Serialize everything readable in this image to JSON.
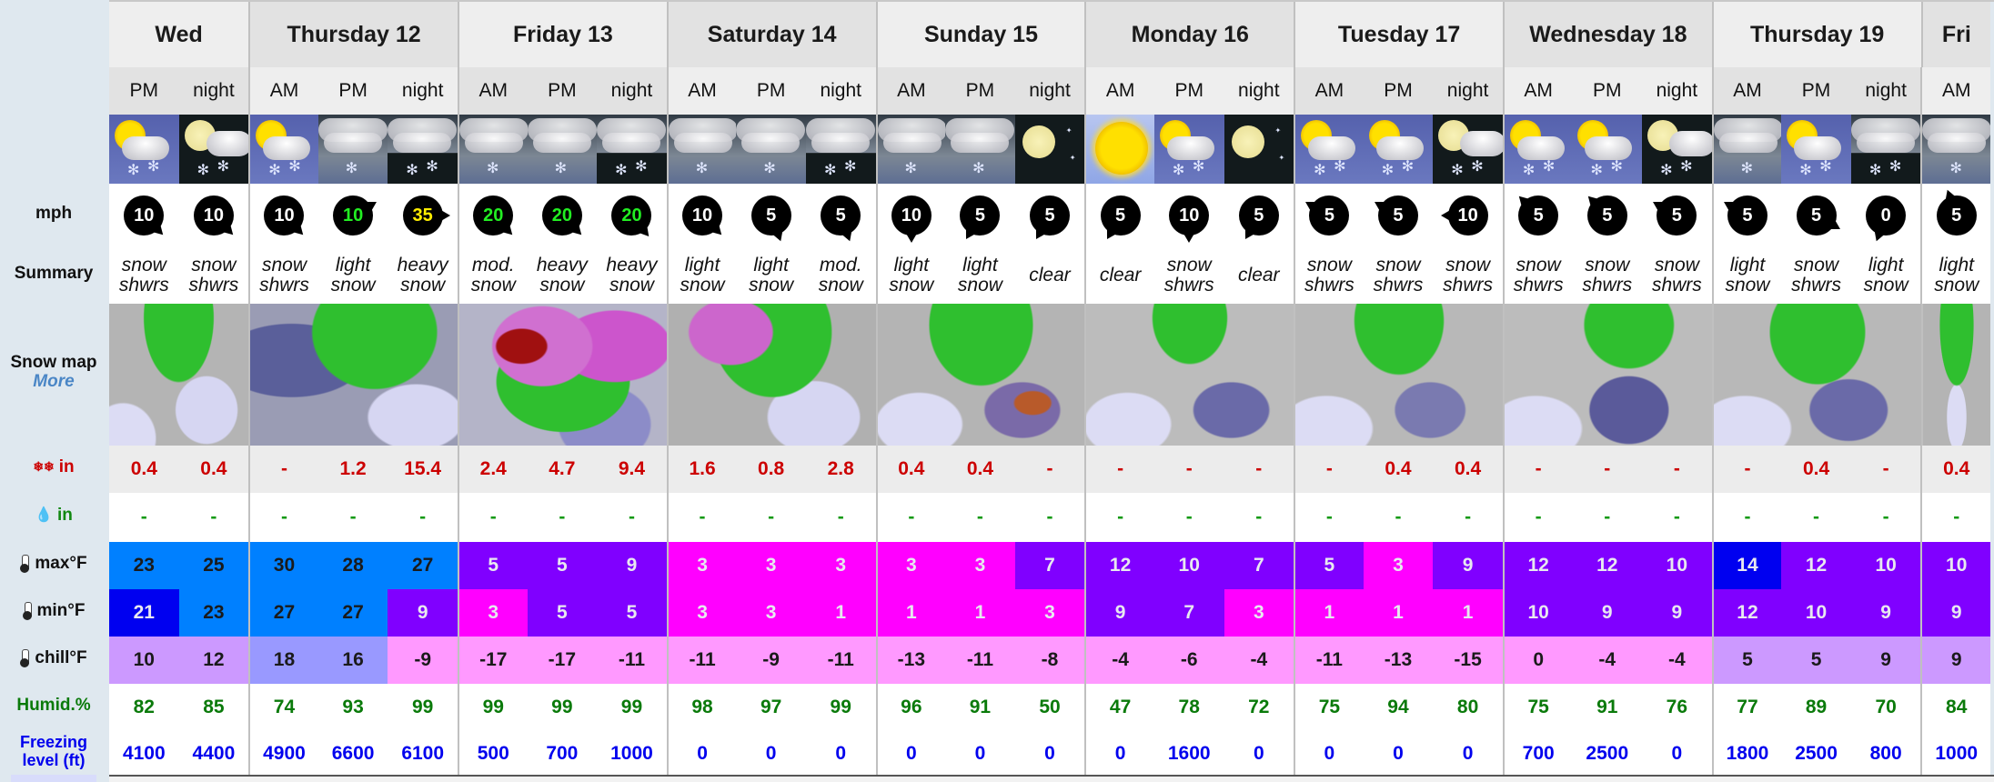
{
  "labels": {
    "wind": "mph",
    "summary": "Summary",
    "snow_map": "Snow map",
    "snow_map_more": "More",
    "snow": "in",
    "rain": "in",
    "max": "max°F",
    "min": "min°F",
    "chill": "chill°F",
    "humid": "Humid.%",
    "freezing_line1": "Freezing",
    "freezing_line2": "level (ft)"
  },
  "days": [
    {
      "name": "Wed",
      "periods": 2
    },
    {
      "name": "Thursday 12",
      "periods": 3
    },
    {
      "name": "Friday 13",
      "periods": 3
    },
    {
      "name": "Saturday 14",
      "periods": 3
    },
    {
      "name": "Sunday 15",
      "periods": 3
    },
    {
      "name": "Monday 16",
      "periods": 3
    },
    {
      "name": "Tuesday 17",
      "periods": 3
    },
    {
      "name": "Wednesday 18",
      "periods": 3
    },
    {
      "name": "Thursday 19",
      "periods": 3
    },
    {
      "name": "Fri",
      "periods": 1
    }
  ],
  "colors": {
    "snow_text": "#cc0000",
    "rain_text": "#119911",
    "humid_text": "#0a7a0a",
    "freezing_text": "#0000ee",
    "wind_green": "#22ee22",
    "wind_yellow": "#ffee00",
    "temp_blue_light": "#0080ff",
    "temp_blue_dark": "#0000f0",
    "temp_violet": "#8000ff",
    "temp_magenta": "#ff00ff",
    "chill_lavender": "#cc99ff",
    "chill_periwinkle": "#9999ff",
    "chill_pink": "#ff99ff"
  },
  "columns": [
    {
      "period": "PM",
      "icon": "sun-cloud-snow",
      "wind": 10,
      "wind_dir": 45,
      "wind_color": "white",
      "summary": [
        "snow",
        "shwrs"
      ],
      "snow": "0.4",
      "rain": "-",
      "max": 23,
      "max_bg": "blue_light",
      "min": 21,
      "min_bg": "blue_dark",
      "chill": 10,
      "chill_bg": "lavender",
      "humid": 82,
      "freezing": 4100
    },
    {
      "period": "night",
      "icon": "moon-cloud-snow",
      "wind": 10,
      "wind_dir": 45,
      "wind_color": "white",
      "summary": [
        "snow",
        "shwrs"
      ],
      "snow": "0.4",
      "rain": "-",
      "max": 25,
      "max_bg": "blue_light",
      "min": 23,
      "min_bg": "blue_light",
      "chill": 12,
      "chill_bg": "lavender",
      "humid": 85,
      "freezing": 4400
    },
    {
      "period": "AM",
      "icon": "sun-cloud-snow",
      "wind": 10,
      "wind_dir": 45,
      "wind_color": "white",
      "summary": [
        "snow",
        "shwrs"
      ],
      "snow": "-",
      "rain": "-",
      "max": 30,
      "max_bg": "blue_light",
      "min": 27,
      "min_bg": "blue_light",
      "chill": 18,
      "chill_bg": "periwinkle",
      "humid": 74,
      "freezing": 4900
    },
    {
      "period": "PM",
      "icon": "overcast-snow",
      "wind": 10,
      "wind_dir": -30,
      "wind_color": "green",
      "summary": [
        "light",
        "snow"
      ],
      "snow": "1.2",
      "rain": "-",
      "max": 28,
      "max_bg": "blue_light",
      "min": 27,
      "min_bg": "blue_light",
      "chill": 16,
      "chill_bg": "periwinkle",
      "humid": 93,
      "freezing": 6600
    },
    {
      "period": "night",
      "icon": "overcast-night-snow",
      "wind": 35,
      "wind_dir": 0,
      "wind_color": "yellow",
      "summary": [
        "heavy",
        "snow"
      ],
      "snow": "15.4",
      "rain": "-",
      "max": 27,
      "max_bg": "blue_light",
      "min": 9,
      "min_bg": "violet",
      "chill": -9,
      "chill_bg": "pink",
      "humid": 99,
      "freezing": 6100
    },
    {
      "period": "AM",
      "icon": "overcast-snow",
      "wind": 20,
      "wind_dir": 45,
      "wind_color": "green",
      "summary": [
        "mod.",
        "snow"
      ],
      "snow": "2.4",
      "rain": "-",
      "max": 5,
      "max_bg": "violet",
      "min": 3,
      "min_bg": "magenta",
      "chill": -17,
      "chill_bg": "pink",
      "humid": 99,
      "freezing": 500
    },
    {
      "period": "PM",
      "icon": "overcast-snow",
      "wind": 20,
      "wind_dir": 45,
      "wind_color": "green",
      "summary": [
        "heavy",
        "snow"
      ],
      "snow": "4.7",
      "rain": "-",
      "max": 5,
      "max_bg": "violet",
      "min": 5,
      "min_bg": "violet",
      "chill": -17,
      "chill_bg": "pink",
      "humid": 99,
      "freezing": 700
    },
    {
      "period": "night",
      "icon": "overcast-night-snow",
      "wind": 20,
      "wind_dir": 50,
      "wind_color": "green",
      "summary": [
        "heavy",
        "snow"
      ],
      "snow": "9.4",
      "rain": "-",
      "max": 9,
      "max_bg": "violet",
      "min": 5,
      "min_bg": "violet",
      "chill": -11,
      "chill_bg": "pink",
      "humid": 99,
      "freezing": 1000
    },
    {
      "period": "AM",
      "icon": "overcast-snow",
      "wind": 10,
      "wind_dir": 45,
      "wind_color": "white",
      "summary": [
        "light",
        "snow"
      ],
      "snow": "1.6",
      "rain": "-",
      "max": 3,
      "max_bg": "magenta",
      "min": 3,
      "min_bg": "magenta",
      "chill": -11,
      "chill_bg": "pink",
      "humid": 98,
      "freezing": 0
    },
    {
      "period": "PM",
      "icon": "overcast-snow",
      "wind": 5,
      "wind_dir": 70,
      "wind_color": "white",
      "summary": [
        "light",
        "snow"
      ],
      "snow": "0.8",
      "rain": "-",
      "max": 3,
      "max_bg": "magenta",
      "min": 3,
      "min_bg": "magenta",
      "chill": -9,
      "chill_bg": "pink",
      "humid": 97,
      "freezing": 0
    },
    {
      "period": "night",
      "icon": "overcast-night-snow",
      "wind": 5,
      "wind_dir": 70,
      "wind_color": "white",
      "summary": [
        "mod.",
        "snow"
      ],
      "snow": "2.8",
      "rain": "-",
      "max": 3,
      "max_bg": "magenta",
      "min": 1,
      "min_bg": "magenta",
      "chill": -11,
      "chill_bg": "pink",
      "humid": 99,
      "freezing": 0
    },
    {
      "period": "AM",
      "icon": "overcast-snow",
      "wind": 10,
      "wind_dir": 90,
      "wind_color": "white",
      "summary": [
        "light",
        "snow"
      ],
      "snow": "0.4",
      "rain": "-",
      "max": 3,
      "max_bg": "magenta",
      "min": 1,
      "min_bg": "magenta",
      "chill": -13,
      "chill_bg": "pink",
      "humid": 96,
      "freezing": 0
    },
    {
      "period": "PM",
      "icon": "overcast-snow",
      "wind": 5,
      "wind_dir": 120,
      "wind_color": "white",
      "summary": [
        "light",
        "snow"
      ],
      "snow": "0.4",
      "rain": "-",
      "max": 3,
      "max_bg": "magenta",
      "min": 1,
      "min_bg": "magenta",
      "chill": -11,
      "chill_bg": "pink",
      "humid": 91,
      "freezing": 0
    },
    {
      "period": "night",
      "icon": "moon-clear",
      "wind": 5,
      "wind_dir": 120,
      "wind_color": "white",
      "summary": [
        "clear"
      ],
      "snow": "-",
      "rain": "-",
      "max": 7,
      "max_bg": "violet",
      "min": 3,
      "min_bg": "magenta",
      "chill": -8,
      "chill_bg": "pink",
      "humid": 50,
      "freezing": 0
    },
    {
      "period": "AM",
      "icon": "sun-clear",
      "wind": 5,
      "wind_dir": 120,
      "wind_color": "white",
      "summary": [
        "clear"
      ],
      "snow": "-",
      "rain": "-",
      "max": 12,
      "max_bg": "violet",
      "min": 9,
      "min_bg": "violet",
      "chill": -4,
      "chill_bg": "pink",
      "humid": 47,
      "freezing": 0
    },
    {
      "period": "PM",
      "icon": "sun-cloud-snow",
      "wind": 10,
      "wind_dir": 90,
      "wind_color": "white",
      "summary": [
        "snow",
        "shwrs"
      ],
      "snow": "-",
      "rain": "-",
      "max": 10,
      "max_bg": "violet",
      "min": 7,
      "min_bg": "violet",
      "chill": -6,
      "chill_bg": "pink",
      "humid": 78,
      "freezing": 1600
    },
    {
      "period": "night",
      "icon": "moon-clear",
      "wind": 5,
      "wind_dir": 120,
      "wind_color": "white",
      "summary": [
        "clear"
      ],
      "snow": "-",
      "rain": "-",
      "max": 7,
      "max_bg": "violet",
      "min": 3,
      "min_bg": "magenta",
      "chill": -4,
      "chill_bg": "pink",
      "humid": 72,
      "freezing": 0
    },
    {
      "period": "AM",
      "icon": "sun-cloud-snow",
      "wind": 5,
      "wind_dir": 210,
      "wind_color": "white",
      "summary": [
        "snow",
        "shwrs"
      ],
      "snow": "-",
      "rain": "-",
      "max": 5,
      "max_bg": "violet",
      "min": 1,
      "min_bg": "magenta",
      "chill": -11,
      "chill_bg": "pink",
      "humid": 75,
      "freezing": 0
    },
    {
      "period": "PM",
      "icon": "sun-cloud-snow",
      "wind": 5,
      "wind_dir": 210,
      "wind_color": "white",
      "summary": [
        "snow",
        "shwrs"
      ],
      "snow": "0.4",
      "rain": "-",
      "max": 3,
      "max_bg": "magenta",
      "min": 1,
      "min_bg": "magenta",
      "chill": -13,
      "chill_bg": "pink",
      "humid": 94,
      "freezing": 0
    },
    {
      "period": "night",
      "icon": "moon-cloud-snow",
      "wind": 10,
      "wind_dir": 180,
      "wind_color": "white",
      "summary": [
        "snow",
        "shwrs"
      ],
      "snow": "0.4",
      "rain": "-",
      "max": 9,
      "max_bg": "violet",
      "min": 1,
      "min_bg": "magenta",
      "chill": -15,
      "chill_bg": "pink",
      "humid": 80,
      "freezing": 0
    },
    {
      "period": "AM",
      "icon": "sun-cloud-snow",
      "wind": 5,
      "wind_dir": 225,
      "wind_color": "white",
      "summary": [
        "snow",
        "shwrs"
      ],
      "snow": "-",
      "rain": "-",
      "max": 12,
      "max_bg": "violet",
      "min": 10,
      "min_bg": "violet",
      "chill": 0,
      "chill_bg": "pink",
      "humid": 75,
      "freezing": 700
    },
    {
      "period": "PM",
      "icon": "sun-cloud-snow",
      "wind": 5,
      "wind_dir": 225,
      "wind_color": "white",
      "summary": [
        "snow",
        "shwrs"
      ],
      "snow": "-",
      "rain": "-",
      "max": 12,
      "max_bg": "violet",
      "min": 9,
      "min_bg": "violet",
      "chill": -4,
      "chill_bg": "pink",
      "humid": 91,
      "freezing": 2500
    },
    {
      "period": "night",
      "icon": "moon-cloud-snow",
      "wind": 5,
      "wind_dir": 210,
      "wind_color": "white",
      "summary": [
        "snow",
        "shwrs"
      ],
      "snow": "-",
      "rain": "-",
      "max": 10,
      "max_bg": "violet",
      "min": 9,
      "min_bg": "violet",
      "chill": -4,
      "chill_bg": "pink",
      "humid": 76,
      "freezing": 0
    },
    {
      "period": "AM",
      "icon": "overcast-snow",
      "wind": 5,
      "wind_dir": 210,
      "wind_color": "white",
      "summary": [
        "light",
        "snow"
      ],
      "snow": "-",
      "rain": "-",
      "max": 14,
      "max_bg": "blue_dark",
      "min": 12,
      "min_bg": "violet",
      "chill": 5,
      "chill_bg": "lavender",
      "humid": 77,
      "freezing": 1800
    },
    {
      "period": "PM",
      "icon": "sun-cloud-snow",
      "wind": 5,
      "wind_dir": 30,
      "wind_color": "white",
      "summary": [
        "snow",
        "shwrs"
      ],
      "snow": "0.4",
      "rain": "-",
      "max": 12,
      "max_bg": "violet",
      "min": 10,
      "min_bg": "violet",
      "chill": 5,
      "chill_bg": "lavender",
      "humid": 89,
      "freezing": 2500
    },
    {
      "period": "night",
      "icon": "overcast-night-snow",
      "wind": 0,
      "wind_dir": 110,
      "wind_color": "white",
      "summary": [
        "light",
        "snow"
      ],
      "snow": "-",
      "rain": "-",
      "max": 10,
      "max_bg": "violet",
      "min": 9,
      "min_bg": "violet",
      "chill": 9,
      "chill_bg": "lavender",
      "humid": 70,
      "freezing": 800
    },
    {
      "period": "AM",
      "icon": "overcast-snow",
      "wind": 5,
      "wind_dir": 250,
      "wind_color": "white",
      "summary": [
        "light",
        "snow"
      ],
      "snow": "0.4",
      "rain": "-",
      "max": 10,
      "max_bg": "violet",
      "min": 9,
      "min_bg": "violet",
      "chill": 9,
      "chill_bg": "lavender",
      "humid": 84,
      "freezing": 1000
    }
  ]
}
